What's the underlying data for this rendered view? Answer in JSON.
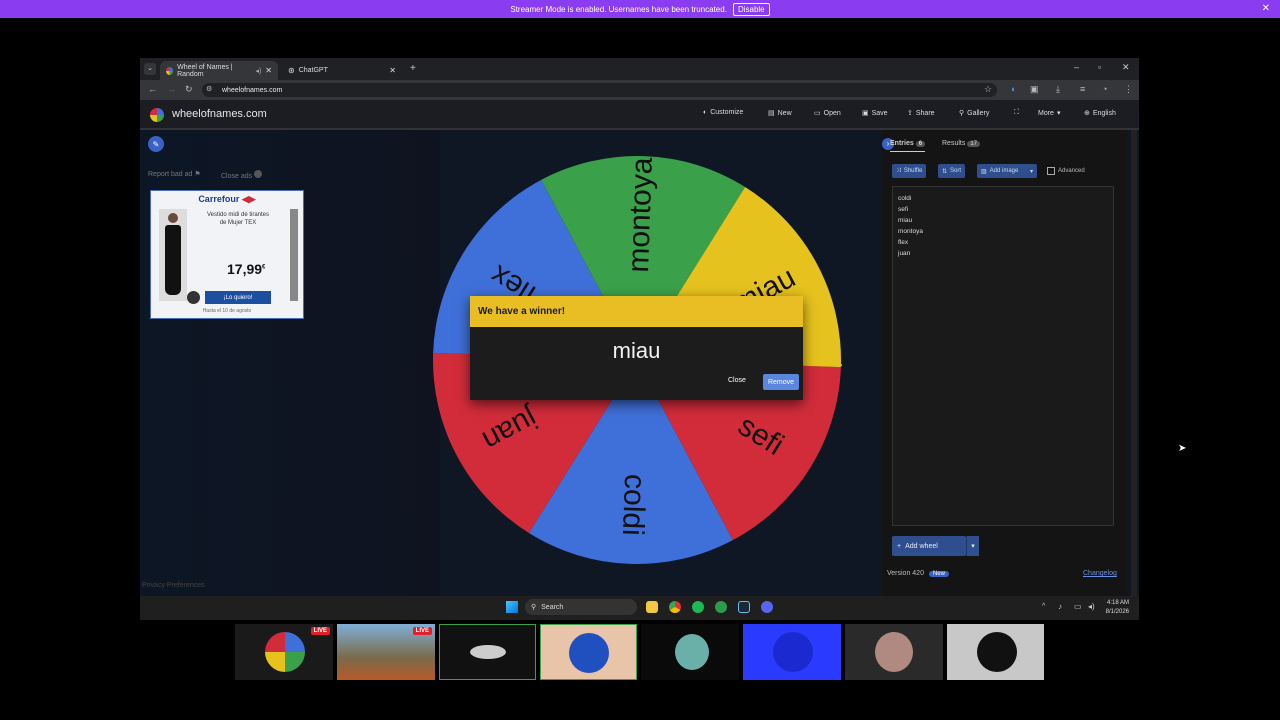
{
  "streamer_bar": {
    "message": "Streamer Mode is enabled. Usernames have been truncated.",
    "disable_label": "Disable"
  },
  "browser": {
    "tabs": [
      {
        "title": "Wheel of Names | Random"
      },
      {
        "title": "ChatGPT"
      }
    ],
    "url": "wheelofnames.com"
  },
  "site": {
    "name": "wheelofnames.com",
    "menu": [
      "Customize",
      "New",
      "Open",
      "Save",
      "Share",
      "Gallery",
      "More",
      "English"
    ],
    "left": {
      "report_ad": "Report bad ad",
      "close_ads": "Close ads"
    },
    "ad": {
      "brand": "Carrefour",
      "product": "Vestido midi de tirantes de Mujer TEX",
      "price": "17,99",
      "currency": "€",
      "cta": "¡Lo quiero!",
      "footer": "Hasta el 10 de agosto"
    },
    "wheel": {
      "colors": [
        "#3f6fd8",
        "#3aa04a",
        "#e6c21e",
        "#d22c3a"
      ],
      "entries": [
        "coldi",
        "sefi",
        "miau",
        "montoya",
        "flex",
        "juan"
      ]
    },
    "dialog": {
      "title": "We have a winner!",
      "winner": "miau",
      "close_label": "Close",
      "remove_label": "Remove"
    },
    "panel": {
      "tab_entries": "Entries",
      "entries_count": "6",
      "tab_results": "Results",
      "results_count": "17",
      "shuffle": "Shuffle",
      "sort": "Sort",
      "add_image": "Add image",
      "advanced": "Advanced",
      "add_wheel": "Add wheel",
      "version": "Version 420",
      "version_badge": "New",
      "changelog": "Changelog"
    },
    "privacy": "Privacy Preferences"
  },
  "taskbar": {
    "search": "Search",
    "time": "4:18 AM",
    "date": "8/1/2026"
  },
  "streams": {
    "live_label": "LIVE"
  }
}
